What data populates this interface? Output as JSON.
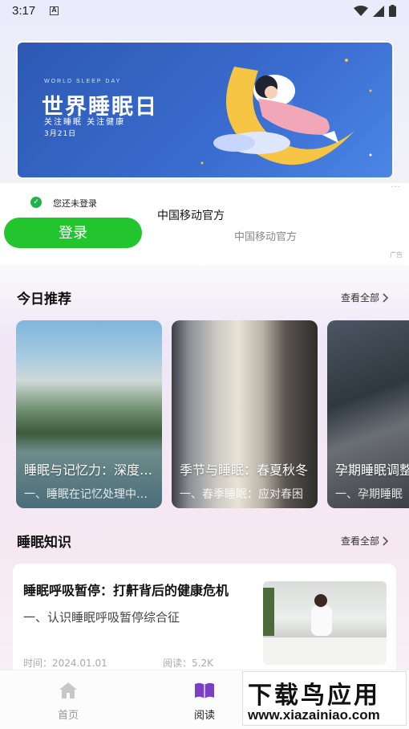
{
  "status_bar": {
    "time": "3:17",
    "notification_icon": "A"
  },
  "banner": {
    "en_text": "WORLD SLEEP DAY",
    "cn_title": "世界睡眠日",
    "subtitle": "关注睡眠  关注健康",
    "date": "3月21日"
  },
  "ad": {
    "not_logged_in": "您还未登录",
    "login_button": "登录",
    "title": "中国移动官方",
    "subtitle": "中国移动官方",
    "tag": "广告",
    "more": "···"
  },
  "recommend": {
    "title": "今日推荐",
    "see_all": "查看全部",
    "cards": [
      {
        "title": "睡眠与记忆力：深度解析",
        "summary": "一、睡眠在记忆处理中的作用"
      },
      {
        "title": "季节与睡眠：春夏秋冬",
        "summary": "一、春季睡眠：应对春困"
      },
      {
        "title": "孕期睡眠调整",
        "summary": "一、孕期睡眠"
      }
    ]
  },
  "knowledge": {
    "title": "睡眠知识",
    "see_all": "查看全部",
    "article": {
      "title": "睡眠呼吸暂停：打鼾背后的健康危机",
      "summary": "一、认识睡眠呼吸暂停综合征",
      "date": "时间：2024.01.01",
      "reads": "阅读：5.2K"
    }
  },
  "tabbar": {
    "items": [
      {
        "label": "首页",
        "icon": "home-icon",
        "active": false
      },
      {
        "label": "阅读",
        "icon": "book-icon",
        "active": true
      }
    ]
  },
  "watermark": {
    "line1": "下载鸟应用",
    "line2": "www.xiazainiao.com"
  },
  "colors": {
    "accent": "#7b3fc4",
    "login_green": "#22c52d",
    "inactive_tab": "#999999"
  }
}
